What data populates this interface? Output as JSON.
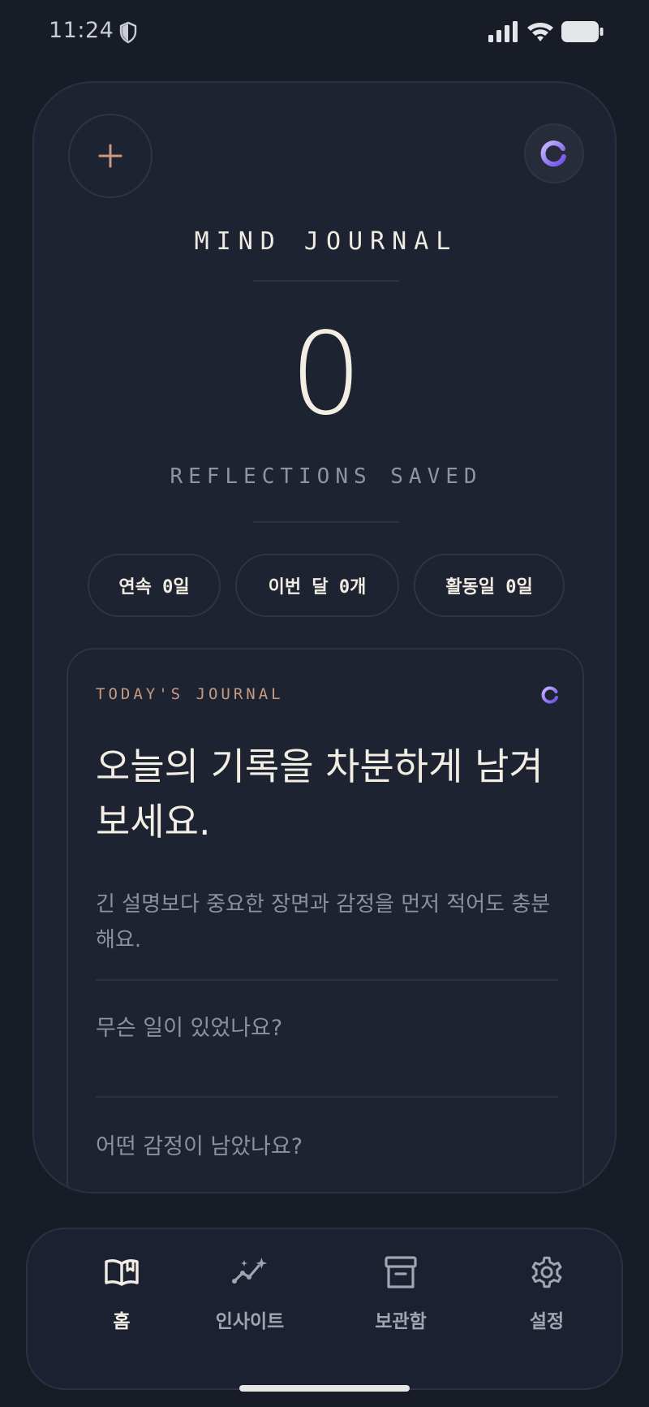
{
  "status_bar": {
    "time": "11:24"
  },
  "header": {
    "app_title": "MIND JOURNAL",
    "reflection_count": "0",
    "count_label": "REFLECTIONS SAVED"
  },
  "stats": [
    {
      "label": "연속 0일"
    },
    {
      "label": "이번 달 0개"
    },
    {
      "label": "활동일 0일"
    }
  ],
  "journal": {
    "label": "TODAY'S JOURNAL",
    "heading": "오늘의 기록을 차분하게 남겨보세요.",
    "description": "긴 설명보다 중요한 장면과 감정을 먼저 적어도 충분해요.",
    "prompts": [
      "무슨 일이 있었나요?",
      "어떤 감정이 남았나요?"
    ]
  },
  "nav": {
    "items": [
      {
        "label": "홈",
        "icon": "book-open-icon",
        "active": true
      },
      {
        "label": "인사이트",
        "icon": "sparkle-chart-icon",
        "active": false
      },
      {
        "label": "보관함",
        "icon": "archive-icon",
        "active": false
      },
      {
        "label": "설정",
        "icon": "gear-icon",
        "active": false
      }
    ]
  },
  "colors": {
    "background": "#171c27",
    "card": "#1d2331",
    "accent_peach": "#c89a80",
    "accent_purple": "#8a6cf0",
    "text_primary": "#f3eee4",
    "text_muted": "#8c919d"
  }
}
